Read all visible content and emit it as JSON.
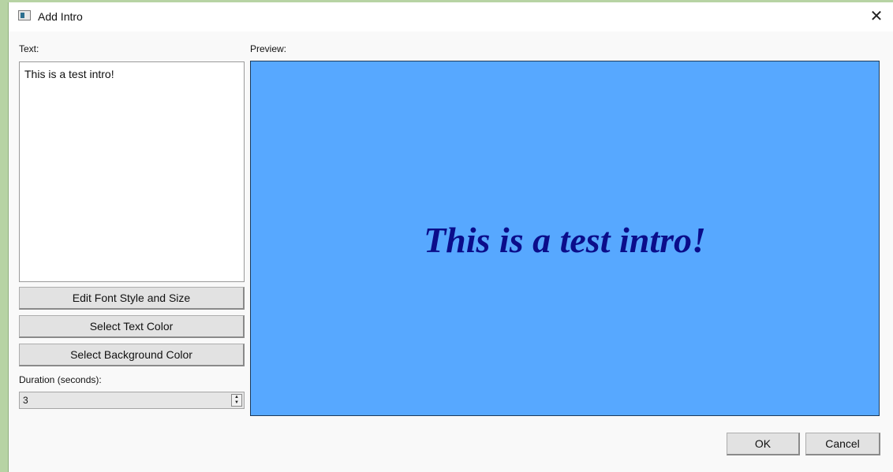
{
  "window": {
    "title": "Add Intro",
    "close_glyph": "✕",
    "icon": "window-app-icon"
  },
  "left": {
    "text_label": "Text:",
    "text_value": "This is a test intro!",
    "buttons": {
      "edit_font": "Edit Font Style and Size",
      "select_text_color": "Select Text Color",
      "select_bg_color": "Select Background Color"
    },
    "duration_label": "Duration (seconds):",
    "duration_value": "3"
  },
  "preview": {
    "label": "Preview:",
    "text": "This is a test intro!",
    "background_color": "#57a8ff",
    "text_color": "#0b0d8a"
  },
  "footer": {
    "ok_label": "OK",
    "cancel_label": "Cancel"
  },
  "icons": {
    "spin_up": "▲",
    "spin_down": "▼"
  }
}
